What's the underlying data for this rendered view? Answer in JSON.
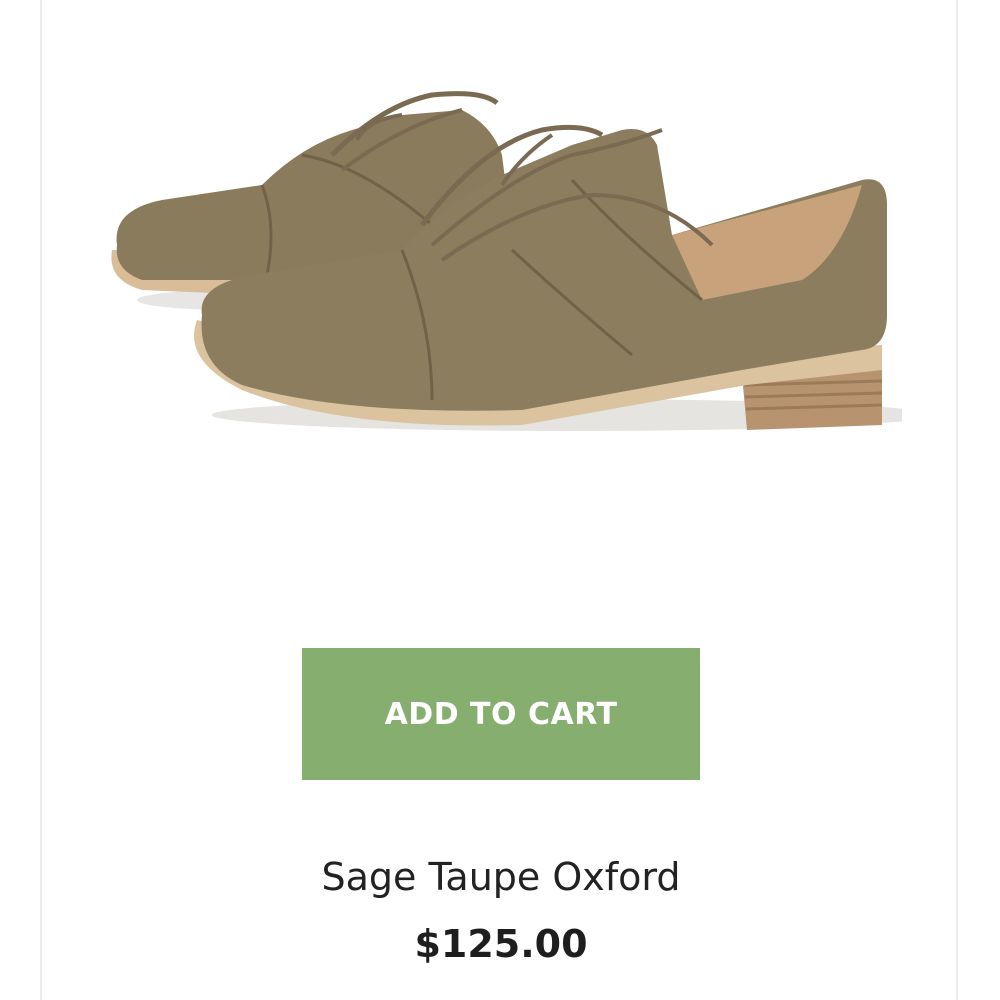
{
  "product": {
    "name": "Sage Taupe Oxford",
    "price": "$125.00",
    "add_to_cart_label": "ADD TO CART",
    "image_icon": "shoe-product-image"
  },
  "colors": {
    "button_bg": "#86ae6f",
    "button_text": "#ffffff",
    "shoe_upper": "#8a7b5c",
    "sole": "#d9bd98"
  }
}
